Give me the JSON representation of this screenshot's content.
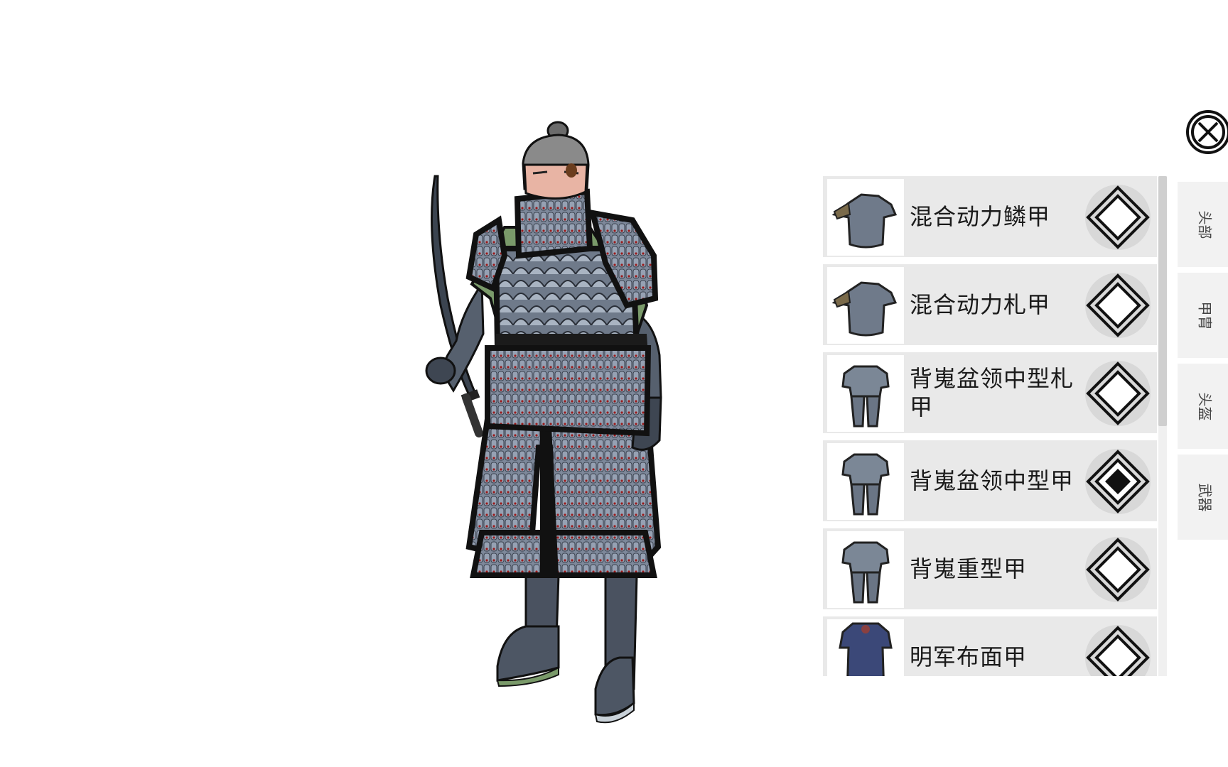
{
  "items": [
    {
      "name": "混合动力鳞甲",
      "thumb": "scale-armor-vest",
      "selected": false
    },
    {
      "name": "混合动力札甲",
      "thumb": "lamellar-armor-vest",
      "selected": false
    },
    {
      "name": "背嵬盆领中型札甲",
      "thumb": "medium-lamellar-full",
      "selected": false
    },
    {
      "name": "背嵬盆领中型甲",
      "thumb": "medium-armor-full",
      "selected": true
    },
    {
      "name": "背嵬重型甲",
      "thumb": "heavy-armor-full",
      "selected": false
    },
    {
      "name": "明军布面甲",
      "thumb": "ming-brigandine",
      "selected": false
    }
  ],
  "tabs": [
    {
      "label": "头部"
    },
    {
      "label": "甲胄"
    },
    {
      "label": "头盔"
    },
    {
      "label": "武器"
    }
  ],
  "icons": {
    "close": "close-circle-icon",
    "select": "diamond-select-icon"
  },
  "colors": {
    "item_bg": "#e9e9e9",
    "tab_bg": "#f2f2f2",
    "armor_steel": "#7b8796",
    "armor_trim": "#1b1b1b",
    "padding_green": "#7a9a6a"
  }
}
